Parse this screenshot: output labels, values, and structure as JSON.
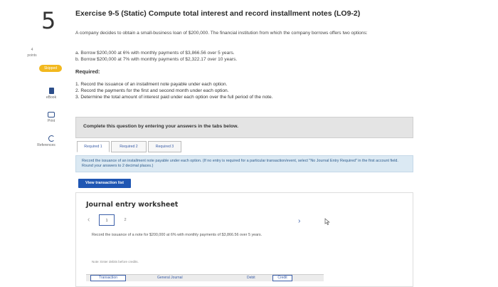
{
  "question": {
    "number": "5",
    "points_value": "4",
    "points_label": "points",
    "status": "Skipped"
  },
  "tools": {
    "ebook": "eBook",
    "print": "Print",
    "references": "References"
  },
  "title": "Exercise 9-5 (Static) Compute total interest and record installment notes (LO9-2)",
  "intro": "A company decides to obtain a small-business loan of $200,000. The financial institution from which the company borrows offers two options:",
  "options": [
    "a. Borrow $200,000 at 6% with monthly payments of $3,866.56 over 5 years.",
    "b. Borrow $200,000 at 7% with monthly payments of $2,322.17 over 10 years."
  ],
  "required_heading": "Required:",
  "required": [
    "1. Record the issuance of an installment note payable under each option.",
    "2. Record the payments for the first and second month under each option.",
    "3. Determine the total amount of interest paid under each option over the full period of the note."
  ],
  "banner": "Complete this question by entering your answers in the tabs below.",
  "tabs": [
    "Required 1",
    "Required 2",
    "Required 3"
  ],
  "instruction": "Record the issuance of an installment note payable under each option. (If no entry is required for a particular transaction/event, select \"No Journal Entry Required\" in the first account field. Round your answers to 2 decimal places.)",
  "view_button": "View transaction list",
  "worksheet": {
    "title": "Journal entry worksheet",
    "pages": [
      "1",
      "2"
    ],
    "description": "Record the issuance of a note for $200,000 at 6% with monthly payments of $3,866.56 over 5 years.",
    "note": "Note: Enter debits before credits.",
    "columns": [
      "Transaction",
      "General Journal",
      "Debit",
      "Credit"
    ]
  }
}
